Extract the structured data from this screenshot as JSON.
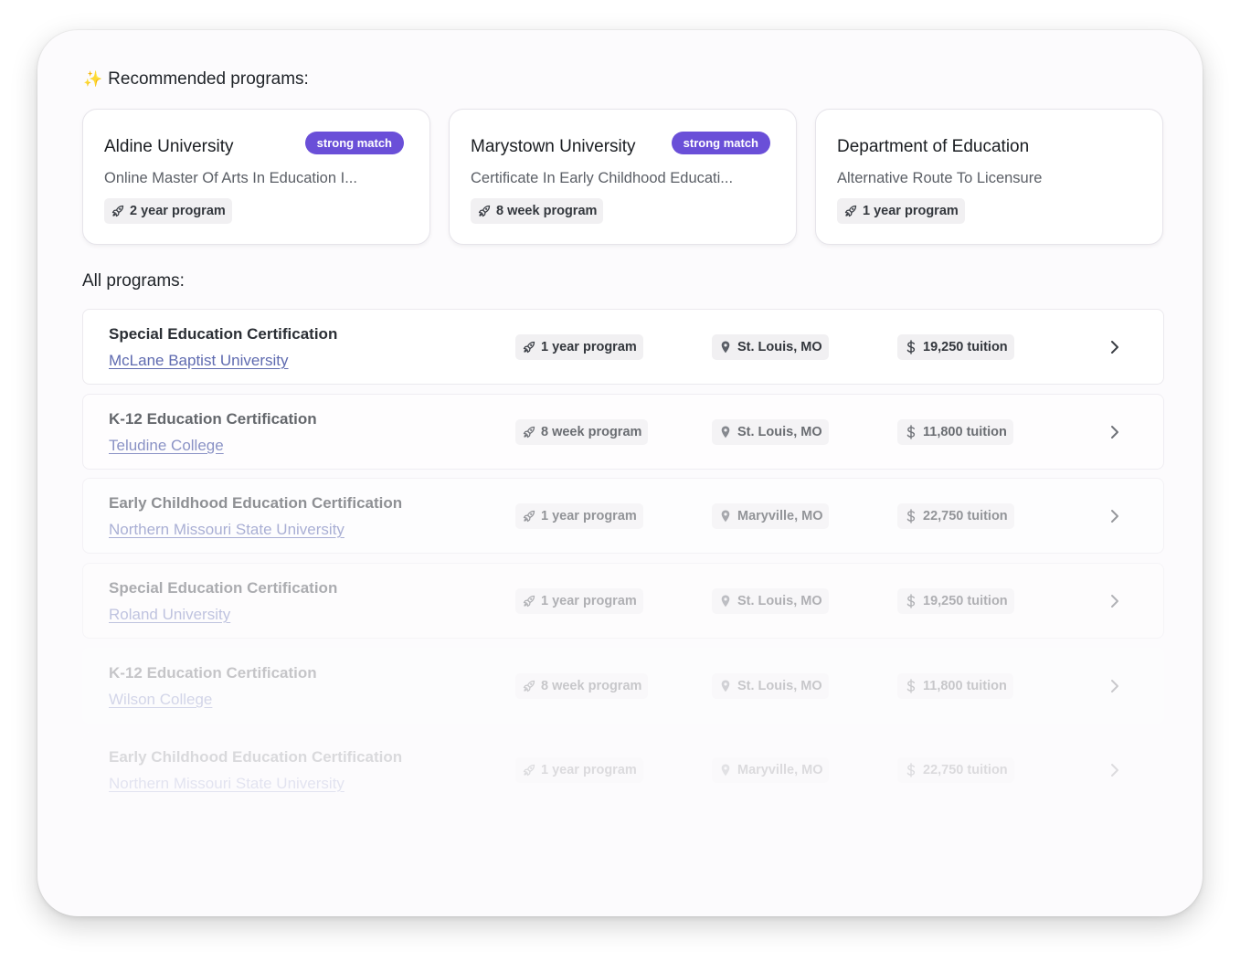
{
  "recommended": {
    "heading": "Recommended programs:",
    "cards": [
      {
        "university": "Aldine University",
        "badge": "strong match",
        "program": "Online Master Of Arts In Education I...",
        "duration": "2 year program"
      },
      {
        "university": "Marystown University",
        "badge": "strong match",
        "program": "Certificate In Early Childhood Educati...",
        "duration": "8 week program"
      },
      {
        "university": "Department of Education",
        "badge": "",
        "program": "Alternative Route To Licensure",
        "duration": "1 year program"
      }
    ]
  },
  "all_programs": {
    "heading": "All programs:",
    "rows": [
      {
        "title": "Special Education Certification",
        "school": "McLane Baptist University",
        "duration": "1 year program",
        "location": "St. Louis, MO",
        "tuition": "19,250 tuition"
      },
      {
        "title": "K-12 Education Certification",
        "school": "Teludine College",
        "duration": "8 week program",
        "location": "St. Louis, MO",
        "tuition": "11,800 tuition"
      },
      {
        "title": "Early Childhood Education Certification",
        "school": "Northern Missouri State University",
        "duration": "1 year program",
        "location": "Maryville, MO",
        "tuition": "22,750 tuition"
      },
      {
        "title": "Special Education Certification",
        "school": "Roland University",
        "duration": "1 year program",
        "location": "St. Louis, MO",
        "tuition": "19,250 tuition"
      },
      {
        "title": "K-12 Education Certification",
        "school": "Wilson College",
        "duration": "8 week program",
        "location": "St. Louis, MO",
        "tuition": "11,800 tuition"
      },
      {
        "title": "Early Childhood Education Certification",
        "school": "Northern Missouri State University",
        "duration": "1 year program",
        "location": "Maryville, MO",
        "tuition": "22,750 tuition"
      }
    ]
  },
  "icons": {
    "sparkle": "sparkle-icon",
    "duration": "rocket-icon",
    "location": "map-pin-icon",
    "tuition": "dollar-icon",
    "open": "chevron-right-icon"
  },
  "colors": {
    "badge": "#6a4fd8",
    "link": "#5f6bb0",
    "sparkle": "#f2c14e"
  }
}
